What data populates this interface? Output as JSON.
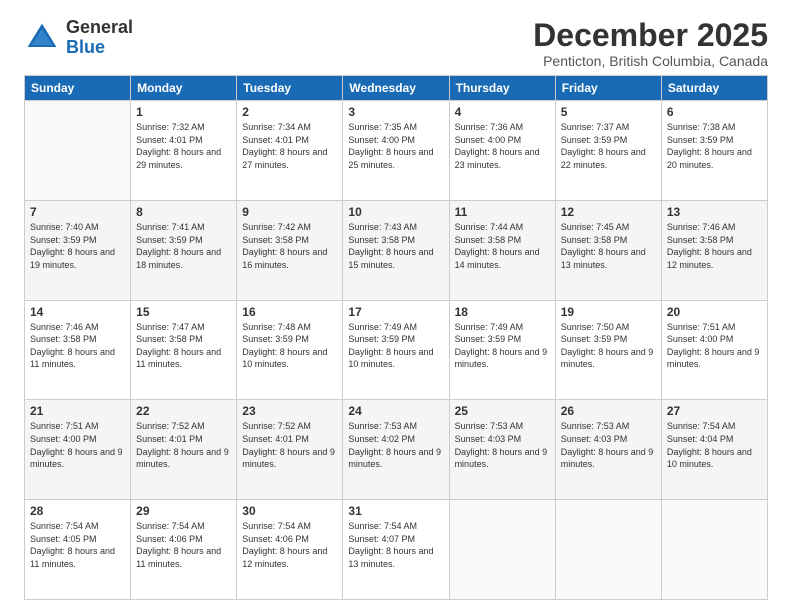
{
  "header": {
    "logo_line1": "General",
    "logo_line2": "Blue",
    "month": "December 2025",
    "location": "Penticton, British Columbia, Canada"
  },
  "weekdays": [
    "Sunday",
    "Monday",
    "Tuesday",
    "Wednesday",
    "Thursday",
    "Friday",
    "Saturday"
  ],
  "weeks": [
    [
      {
        "day": "",
        "sunrise": "",
        "sunset": "",
        "daylight": ""
      },
      {
        "day": "1",
        "sunrise": "Sunrise: 7:32 AM",
        "sunset": "Sunset: 4:01 PM",
        "daylight": "Daylight: 8 hours and 29 minutes."
      },
      {
        "day": "2",
        "sunrise": "Sunrise: 7:34 AM",
        "sunset": "Sunset: 4:01 PM",
        "daylight": "Daylight: 8 hours and 27 minutes."
      },
      {
        "day": "3",
        "sunrise": "Sunrise: 7:35 AM",
        "sunset": "Sunset: 4:00 PM",
        "daylight": "Daylight: 8 hours and 25 minutes."
      },
      {
        "day": "4",
        "sunrise": "Sunrise: 7:36 AM",
        "sunset": "Sunset: 4:00 PM",
        "daylight": "Daylight: 8 hours and 23 minutes."
      },
      {
        "day": "5",
        "sunrise": "Sunrise: 7:37 AM",
        "sunset": "Sunset: 3:59 PM",
        "daylight": "Daylight: 8 hours and 22 minutes."
      },
      {
        "day": "6",
        "sunrise": "Sunrise: 7:38 AM",
        "sunset": "Sunset: 3:59 PM",
        "daylight": "Daylight: 8 hours and 20 minutes."
      }
    ],
    [
      {
        "day": "7",
        "sunrise": "Sunrise: 7:40 AM",
        "sunset": "Sunset: 3:59 PM",
        "daylight": "Daylight: 8 hours and 19 minutes."
      },
      {
        "day": "8",
        "sunrise": "Sunrise: 7:41 AM",
        "sunset": "Sunset: 3:59 PM",
        "daylight": "Daylight: 8 hours and 18 minutes."
      },
      {
        "day": "9",
        "sunrise": "Sunrise: 7:42 AM",
        "sunset": "Sunset: 3:58 PM",
        "daylight": "Daylight: 8 hours and 16 minutes."
      },
      {
        "day": "10",
        "sunrise": "Sunrise: 7:43 AM",
        "sunset": "Sunset: 3:58 PM",
        "daylight": "Daylight: 8 hours and 15 minutes."
      },
      {
        "day": "11",
        "sunrise": "Sunrise: 7:44 AM",
        "sunset": "Sunset: 3:58 PM",
        "daylight": "Daylight: 8 hours and 14 minutes."
      },
      {
        "day": "12",
        "sunrise": "Sunrise: 7:45 AM",
        "sunset": "Sunset: 3:58 PM",
        "daylight": "Daylight: 8 hours and 13 minutes."
      },
      {
        "day": "13",
        "sunrise": "Sunrise: 7:46 AM",
        "sunset": "Sunset: 3:58 PM",
        "daylight": "Daylight: 8 hours and 12 minutes."
      }
    ],
    [
      {
        "day": "14",
        "sunrise": "Sunrise: 7:46 AM",
        "sunset": "Sunset: 3:58 PM",
        "daylight": "Daylight: 8 hours and 11 minutes."
      },
      {
        "day": "15",
        "sunrise": "Sunrise: 7:47 AM",
        "sunset": "Sunset: 3:58 PM",
        "daylight": "Daylight: 8 hours and 11 minutes."
      },
      {
        "day": "16",
        "sunrise": "Sunrise: 7:48 AM",
        "sunset": "Sunset: 3:59 PM",
        "daylight": "Daylight: 8 hours and 10 minutes."
      },
      {
        "day": "17",
        "sunrise": "Sunrise: 7:49 AM",
        "sunset": "Sunset: 3:59 PM",
        "daylight": "Daylight: 8 hours and 10 minutes."
      },
      {
        "day": "18",
        "sunrise": "Sunrise: 7:49 AM",
        "sunset": "Sunset: 3:59 PM",
        "daylight": "Daylight: 8 hours and 9 minutes."
      },
      {
        "day": "19",
        "sunrise": "Sunrise: 7:50 AM",
        "sunset": "Sunset: 3:59 PM",
        "daylight": "Daylight: 8 hours and 9 minutes."
      },
      {
        "day": "20",
        "sunrise": "Sunrise: 7:51 AM",
        "sunset": "Sunset: 4:00 PM",
        "daylight": "Daylight: 8 hours and 9 minutes."
      }
    ],
    [
      {
        "day": "21",
        "sunrise": "Sunrise: 7:51 AM",
        "sunset": "Sunset: 4:00 PM",
        "daylight": "Daylight: 8 hours and 9 minutes."
      },
      {
        "day": "22",
        "sunrise": "Sunrise: 7:52 AM",
        "sunset": "Sunset: 4:01 PM",
        "daylight": "Daylight: 8 hours and 9 minutes."
      },
      {
        "day": "23",
        "sunrise": "Sunrise: 7:52 AM",
        "sunset": "Sunset: 4:01 PM",
        "daylight": "Daylight: 8 hours and 9 minutes."
      },
      {
        "day": "24",
        "sunrise": "Sunrise: 7:53 AM",
        "sunset": "Sunset: 4:02 PM",
        "daylight": "Daylight: 8 hours and 9 minutes."
      },
      {
        "day": "25",
        "sunrise": "Sunrise: 7:53 AM",
        "sunset": "Sunset: 4:03 PM",
        "daylight": "Daylight: 8 hours and 9 minutes."
      },
      {
        "day": "26",
        "sunrise": "Sunrise: 7:53 AM",
        "sunset": "Sunset: 4:03 PM",
        "daylight": "Daylight: 8 hours and 9 minutes."
      },
      {
        "day": "27",
        "sunrise": "Sunrise: 7:54 AM",
        "sunset": "Sunset: 4:04 PM",
        "daylight": "Daylight: 8 hours and 10 minutes."
      }
    ],
    [
      {
        "day": "28",
        "sunrise": "Sunrise: 7:54 AM",
        "sunset": "Sunset: 4:05 PM",
        "daylight": "Daylight: 8 hours and 11 minutes."
      },
      {
        "day": "29",
        "sunrise": "Sunrise: 7:54 AM",
        "sunset": "Sunset: 4:06 PM",
        "daylight": "Daylight: 8 hours and 11 minutes."
      },
      {
        "day": "30",
        "sunrise": "Sunrise: 7:54 AM",
        "sunset": "Sunset: 4:06 PM",
        "daylight": "Daylight: 8 hours and 12 minutes."
      },
      {
        "day": "31",
        "sunrise": "Sunrise: 7:54 AM",
        "sunset": "Sunset: 4:07 PM",
        "daylight": "Daylight: 8 hours and 13 minutes."
      },
      {
        "day": "",
        "sunrise": "",
        "sunset": "",
        "daylight": ""
      },
      {
        "day": "",
        "sunrise": "",
        "sunset": "",
        "daylight": ""
      },
      {
        "day": "",
        "sunrise": "",
        "sunset": "",
        "daylight": ""
      }
    ]
  ]
}
